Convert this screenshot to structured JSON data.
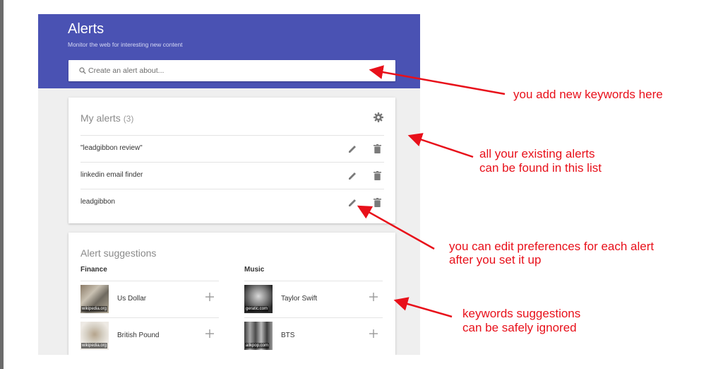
{
  "header": {
    "title": "Alerts",
    "subtitle": "Monitor the web for interesting new content",
    "search_placeholder": "Create an alert about..."
  },
  "my_alerts": {
    "title": "My alerts",
    "count": "(3)",
    "items": [
      {
        "label": "\"leadgibbon review\""
      },
      {
        "label": "linkedin email finder"
      },
      {
        "label": "leadgibbon"
      }
    ]
  },
  "suggestions": {
    "title": "Alert suggestions",
    "columns": [
      {
        "label": "Finance",
        "items": [
          {
            "label": "Us Dollar",
            "thumb_caption": "wikipedia.org"
          },
          {
            "label": "British Pound",
            "thumb_caption": "wikipedia.org"
          }
        ]
      },
      {
        "label": "Music",
        "items": [
          {
            "label": "Taylor Swift",
            "thumb_caption": "geratic.com"
          },
          {
            "label": "BTS",
            "thumb_caption": "allkpop.com"
          }
        ]
      }
    ]
  },
  "annotations": {
    "add_keywords": "you add new keywords here",
    "existing_alerts_line1": "all your existing alerts",
    "existing_alerts_line2": "can be found in this list",
    "edit_prefs_line1": "you can edit preferences for each alert",
    "edit_prefs_line2": "after you set it up",
    "suggestions_line1": "keywords suggestions",
    "suggestions_line2": "can be safely ignored"
  },
  "colors": {
    "header": "#4a52b3",
    "annotation": "#e8101a",
    "background": "#efefef"
  }
}
